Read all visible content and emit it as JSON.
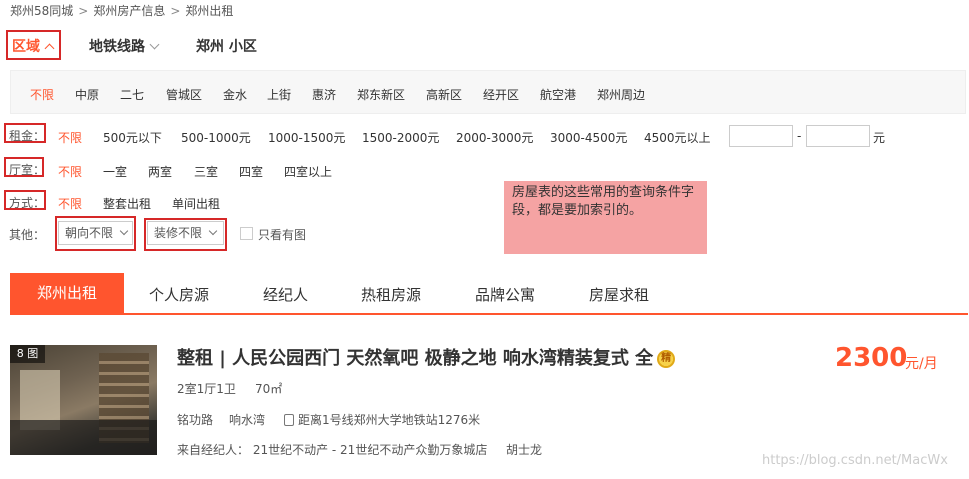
{
  "breadcrumb": [
    "郑州58同城",
    "郑州房产信息",
    "郑州出租"
  ],
  "breadcrumb_sep": ">",
  "top_tabs": {
    "region": "区域",
    "metro": "地铁线路",
    "xiaoqu": "郑州 小区"
  },
  "districts": [
    "不限",
    "中原",
    "二七",
    "管城区",
    "金水",
    "上街",
    "惠济",
    "郑东新区",
    "高新区",
    "经开区",
    "航空港",
    "郑州周边"
  ],
  "filters": {
    "rent": {
      "label": "租金：",
      "options": [
        "不限",
        "500元以下",
        "500-1000元",
        "1000-1500元",
        "1500-2000元",
        "2000-3000元",
        "3000-4500元",
        "4500元以上"
      ],
      "dash": "-",
      "unit": "元"
    },
    "room": {
      "label": "厅室：",
      "options": [
        "不限",
        "一室",
        "两室",
        "三室",
        "四室",
        "四室以上"
      ]
    },
    "mode": {
      "label": "方式：",
      "options": [
        "不限",
        "整套出租",
        "单间出租"
      ]
    },
    "other": {
      "label": "其他：",
      "orientation": "朝向不限",
      "decoration": "装修不限",
      "photo_only": "只看有图"
    }
  },
  "note": "房屋表的这些常用的查询条件字段，都是要加索引的。",
  "list_tabs": [
    "郑州出租",
    "个人房源",
    "经纪人",
    "热租房源",
    "品牌公寓",
    "房屋求租"
  ],
  "listing": {
    "image_count": "8 图",
    "title": "整租 | 人民公园西门 天然氧吧 极静之地 响水湾精装复式 全",
    "medal": "精",
    "layout": "2室1厅1卫",
    "area": "70㎡",
    "road": "铭功路",
    "community": "响水湾",
    "subway": "距离1号线郑州大学地铁站1276米",
    "agent": "来自经纪人： 21世纪不动产 - 21世纪不动产众勤万象城店",
    "agent_name": "胡士龙",
    "price": "2300",
    "price_unit": "元/月"
  },
  "watermark": "https://blog.csdn.net/MacWx",
  "colors": {
    "accent": "#ff552e",
    "annotation_box": "#d62828",
    "note_bg": "#f5a3a3"
  }
}
